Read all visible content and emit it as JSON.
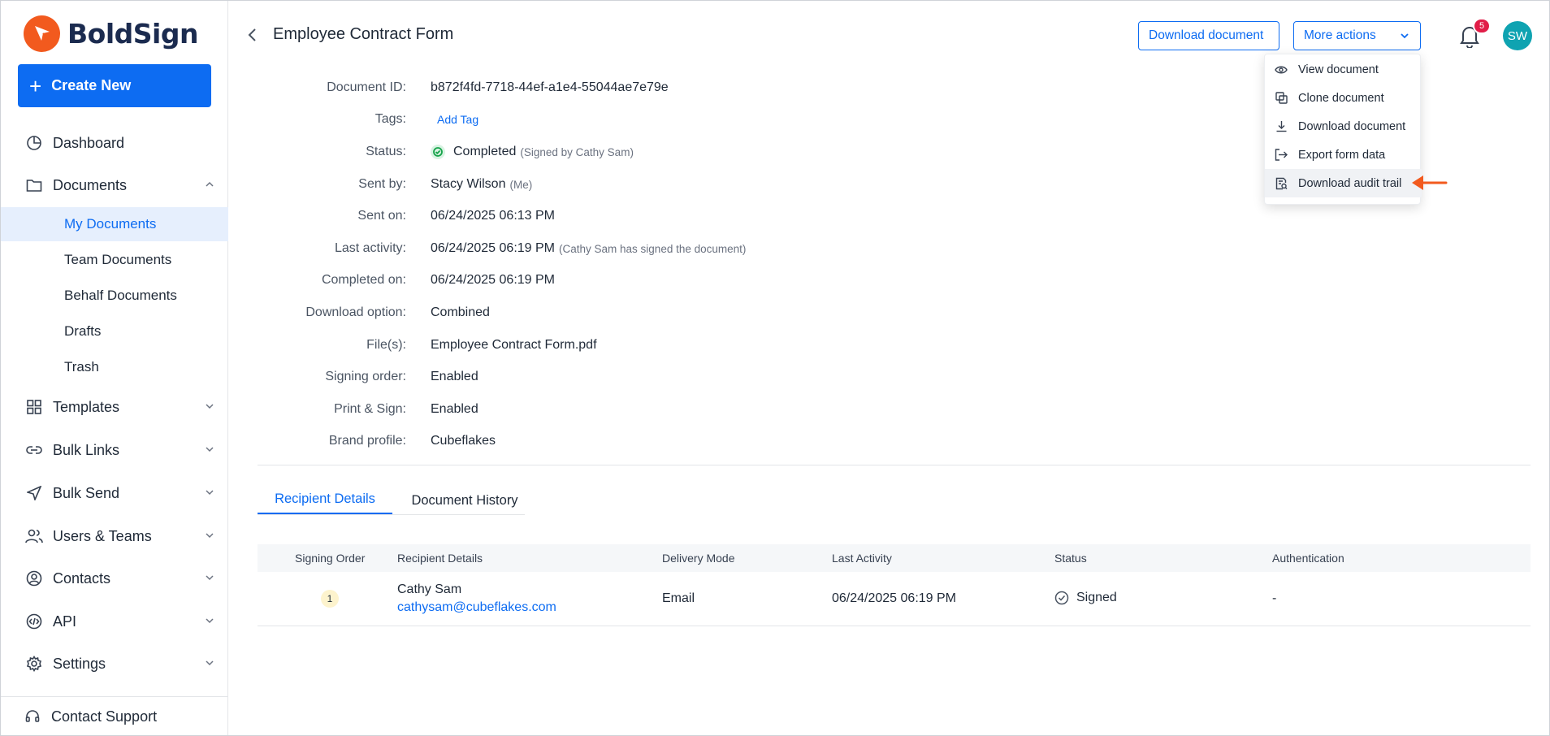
{
  "brand": {
    "name": "BoldSign",
    "accent": "#0d6cf2",
    "logo_color": "#f25a1e"
  },
  "sidebar": {
    "create_label": "Create New",
    "items": [
      {
        "label": "Dashboard",
        "icon": "pie-chart-icon"
      },
      {
        "label": "Documents",
        "icon": "folder-icon"
      },
      {
        "label": "Templates",
        "icon": "grid-icon"
      },
      {
        "label": "Bulk Links",
        "icon": "link-icon"
      },
      {
        "label": "Bulk Send",
        "icon": "send-icon"
      },
      {
        "label": "Users & Teams",
        "icon": "users-icon"
      },
      {
        "label": "Contacts",
        "icon": "contact-icon"
      },
      {
        "label": "API",
        "icon": "api-icon"
      },
      {
        "label": "Settings",
        "icon": "gear-icon"
      }
    ],
    "documents_sub": [
      "My Documents",
      "Team Documents",
      "Behalf Documents",
      "Drafts",
      "Trash"
    ],
    "support_label": "Contact Support"
  },
  "header": {
    "title": "Employee Contract Form",
    "download_label": "Download document",
    "more_label": "More actions",
    "notification_count": "5",
    "avatar_initials": "SW"
  },
  "details": {
    "document_id": {
      "label": "Document ID:",
      "value": "b872f4fd-7718-44ef-a1e4-55044ae7e79e"
    },
    "tags": {
      "label": "Tags:",
      "value": "Add Tag"
    },
    "status": {
      "label": "Status:",
      "value": "Completed",
      "note": "(Signed by Cathy Sam)"
    },
    "sent_by": {
      "label": "Sent by:",
      "value": "Stacy Wilson",
      "note": "(Me)"
    },
    "sent_on": {
      "label": "Sent on:",
      "value": "06/24/2025 06:13 PM"
    },
    "last_activity": {
      "label": "Last activity:",
      "value": "06/24/2025 06:19 PM",
      "note": "(Cathy Sam has signed the document)"
    },
    "completed_on": {
      "label": "Completed on:",
      "value": "06/24/2025 06:19 PM"
    },
    "download_option": {
      "label": "Download option:",
      "value": "Combined"
    },
    "files": {
      "label": "File(s):",
      "value": "Employee Contract Form.pdf"
    },
    "signing_order": {
      "label": "Signing order:",
      "value": "Enabled"
    },
    "print_sign": {
      "label": "Print & Sign:",
      "value": "Enabled"
    },
    "brand_profile": {
      "label": "Brand profile:",
      "value": "Cubeflakes"
    }
  },
  "tabs": [
    "Recipient Details",
    "Document History"
  ],
  "table": {
    "headers": [
      "Signing Order",
      "Recipient Details",
      "Delivery Mode",
      "Last Activity",
      "Status",
      "Authentication"
    ],
    "rows": [
      {
        "order": "1",
        "name": "Cathy Sam",
        "email": "cathysam@cubeflakes.com",
        "delivery": "Email",
        "last_activity": "06/24/2025 06:19 PM",
        "status": "Signed",
        "auth": "-"
      }
    ]
  },
  "menu": {
    "items": [
      {
        "label": "View document",
        "icon": "eye-icon"
      },
      {
        "label": "Clone document",
        "icon": "copy-icon"
      },
      {
        "label": "Download document",
        "icon": "download-icon"
      },
      {
        "label": "Export form data",
        "icon": "export-icon"
      },
      {
        "label": "Download audit trail",
        "icon": "audit-trail-icon"
      }
    ],
    "highlighted": "Download audit trail"
  }
}
